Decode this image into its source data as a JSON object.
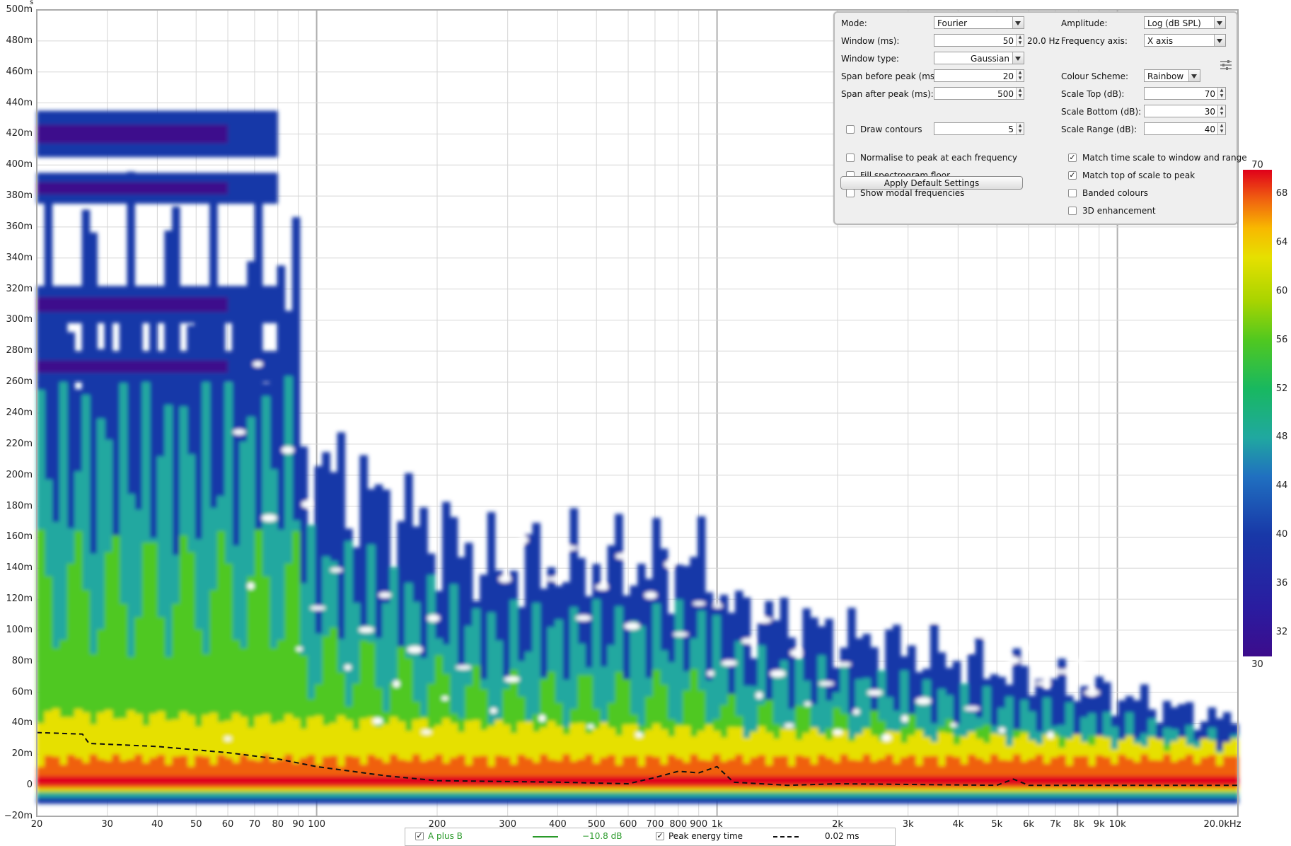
{
  "plot": {
    "y_unit": "s",
    "y_ticks": [
      "500m",
      "480m",
      "460m",
      "440m",
      "420m",
      "400m",
      "380m",
      "360m",
      "340m",
      "320m",
      "300m",
      "280m",
      "260m",
      "240m",
      "220m",
      "200m",
      "180m",
      "160m",
      "140m",
      "120m",
      "100m",
      "80m",
      "60m",
      "40m",
      "20m",
      "0",
      "−20m"
    ],
    "x_ticks": [
      "20",
      "30",
      "40",
      "50",
      "60",
      "70",
      "80",
      "90",
      "100",
      "200",
      "300",
      "400",
      "500",
      "600",
      "700",
      "800",
      "900",
      "1k",
      "2k",
      "3k",
      "4k",
      "5k",
      "6k",
      "7k",
      "8k",
      "9k",
      "10k",
      "20.0kHz"
    ],
    "x_range_hz": [
      20,
      20000
    ],
    "y_range_s": [
      -0.02,
      0.5
    ],
    "x_scale": "log",
    "grid": true,
    "peak_energy_time_curve_s": [
      [
        20,
        0.034
      ],
      [
        26,
        0.033
      ],
      [
        27,
        0.027
      ],
      [
        40,
        0.025
      ],
      [
        60,
        0.021
      ],
      [
        80,
        0.017
      ],
      [
        100,
        0.012
      ],
      [
        150,
        0.006
      ],
      [
        200,
        0.003
      ],
      [
        400,
        0.002
      ],
      [
        600,
        0.001
      ],
      [
        700,
        0.005
      ],
      [
        800,
        0.009
      ],
      [
        900,
        0.008
      ],
      [
        1000,
        0.012
      ],
      [
        1100,
        0.002
      ],
      [
        1500,
        0
      ],
      [
        2000,
        0.001
      ],
      [
        5000,
        0
      ],
      [
        5500,
        0.004
      ],
      [
        6000,
        0
      ],
      [
        20000,
        0
      ]
    ]
  },
  "colorbar": {
    "ticks": [
      "70",
      "68",
      "64",
      "60",
      "56",
      "52",
      "48",
      "44",
      "40",
      "36",
      "32",
      "30"
    ],
    "colors": [
      "#e0001a",
      "#f06010",
      "#f8b800",
      "#e6e000",
      "#a8d400",
      "#50c820",
      "#18b860",
      "#20a8a0",
      "#2070c0",
      "#1838a8",
      "#3c0c8c",
      "#d040c0",
      "#ffffff"
    ]
  },
  "panel": {
    "mode_label": "Mode:",
    "mode_value": "Fourier",
    "window_label": "Window (ms):",
    "window_value": "50",
    "window_freq": "20.0 Hz",
    "window_type_label": "Window type:",
    "window_type_value": "Gaussian",
    "span_before_label": "Span before peak (ms):",
    "span_before_value": "20",
    "span_after_label": "Span after peak (ms):",
    "span_after_value": "500",
    "draw_contours_label": "Draw contours",
    "draw_contours_checked": false,
    "contours_value": "5",
    "amplitude_label": "Amplitude:",
    "amplitude_value": "Log (dB SPL)",
    "freq_axis_label": "Frequency axis:",
    "freq_axis_value": "X axis",
    "colour_scheme_label": "Colour Scheme:",
    "colour_scheme_value": "Rainbow",
    "scale_top_label": "Scale Top (dB):",
    "scale_top_value": "70",
    "scale_bottom_label": "Scale Bottom (dB):",
    "scale_bottom_value": "30",
    "scale_range_label": "Scale Range (dB):",
    "scale_range_value": "40",
    "normalise_label": "Normalise to peak at each frequency",
    "normalise_checked": false,
    "fill_floor_label": "Fill spectrogram floor",
    "fill_floor_checked": false,
    "modal_label": "Show modal frequencies",
    "modal_checked": false,
    "match_time_label": "Match time scale to window and range",
    "match_time_checked": true,
    "match_top_label": "Match top of scale to peak",
    "match_top_checked": true,
    "banded_label": "Banded colours",
    "banded_checked": false,
    "enh3d_label": "3D enhancement",
    "enh3d_checked": false,
    "apply_label": "Apply Default Settings",
    "adjust_icon": "sliders-icon"
  },
  "legend": {
    "trace_name": "A plus B",
    "trace_checked": true,
    "trace_color": "#2a9a2a",
    "trace_value": "−10.8 dB",
    "peak_name": "Peak energy time",
    "peak_checked": true,
    "peak_value": "0.02 ms"
  }
}
